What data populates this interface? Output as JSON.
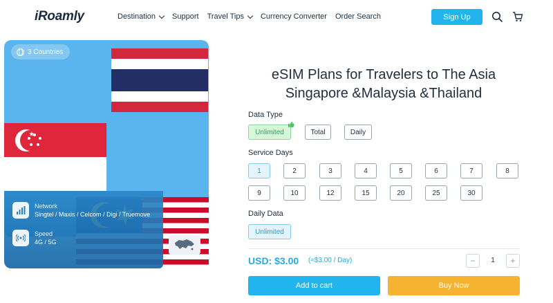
{
  "header": {
    "logo": "iRoamly",
    "nav": [
      {
        "label": "Destination",
        "dropdown": true
      },
      {
        "label": "Support",
        "dropdown": false
      },
      {
        "label": "Travel Tips",
        "dropdown": true
      },
      {
        "label": "Currency Converter",
        "dropdown": false
      },
      {
        "label": "Order Search",
        "dropdown": false
      }
    ],
    "signup_label": "Sign Up",
    "icons": [
      "search-icon",
      "cart-icon"
    ]
  },
  "hero": {
    "countries_badge": "3 Countries",
    "flags": [
      "thailand-flag",
      "singapore-flag",
      "malaysia-flag"
    ],
    "network_label": "Network",
    "network_value": "Singtel / Maxis / Celcom / Digi / Truemove",
    "speed_label": "Speed",
    "speed_value": "4G / 5G"
  },
  "product": {
    "title_line1": "eSIM Plans for Travelers to The Asia",
    "title_line2": "Singapore &Malaysia &Thailand",
    "data_type_label": "Data Type",
    "data_types": [
      "Unlimited",
      "Total",
      "Daily"
    ],
    "data_type_selected": "Unlimited",
    "service_days_label": "Service Days",
    "service_days": [
      "1",
      "2",
      "3",
      "4",
      "5",
      "6",
      "7",
      "8",
      "9",
      "10",
      "12",
      "15",
      "20",
      "25",
      "30"
    ],
    "service_days_selected": "1",
    "daily_data_label": "Daily Data",
    "daily_data_options": [
      "Unlimited"
    ],
    "price": "USD: $3.00",
    "price_per_day": "(≈$3.00 / Day)",
    "quantity": "1",
    "qty_minus": "−",
    "qty_plus": "+",
    "add_to_cart": "Add to cart",
    "buy_now": "Buy Now"
  },
  "colors": {
    "accent": "#22b4ec",
    "buy": "#f6b332",
    "selected_green": "#2da84a",
    "hero_bg": "#5ab5ee"
  }
}
